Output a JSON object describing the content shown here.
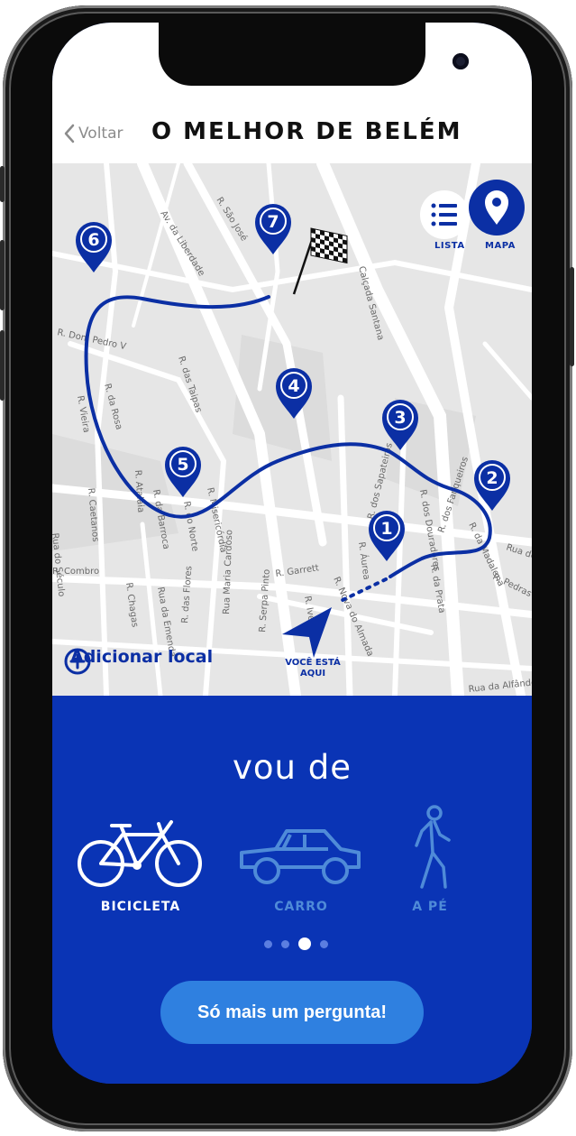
{
  "header": {
    "back_label": "Voltar",
    "title": "O MELHOR DE BELÉM"
  },
  "view_toggle": {
    "list_label": "LISTA",
    "map_label": "MAPA",
    "active": "MAPA"
  },
  "map": {
    "streets": [
      "Av. da Liberdade",
      "R. São José",
      "Calçada Santana",
      "R. Dom Pedro V",
      "R. das Taipas",
      "R. da Rosa",
      "R. Vieira",
      "R. Caetanos",
      "R. Atalaia",
      "R. da Barroca",
      "R. do Norte",
      "R. Misericórdia",
      "R. Garrett",
      "R. Ivens",
      "R. Nova do Almada",
      "R. Áurea",
      "R. dos Sapateiros",
      "R. dos Douradores",
      "R. dos Fanqueiros",
      "R. da Madalena",
      "R. da Prata",
      "Rua da Emenda",
      "R. das Flores",
      "R. Chagas",
      "Rua Maria Cardoso",
      "R. Serpa Pinto",
      "Rua da Alfândega",
      "Rua do Século",
      "R. Combro",
      "R. Pedras",
      "Rua de"
    ],
    "stops": [
      "1",
      "2",
      "3",
      "4",
      "5",
      "6",
      "7"
    ],
    "you_are_here": "VOCÊ ESTÁ AQUI",
    "add_place_label": "Adicionar local"
  },
  "transport": {
    "heading": "vou de",
    "options": [
      {
        "label": "BICICLETA",
        "icon": "bicycle-icon",
        "selected": true
      },
      {
        "label": "CARRO",
        "icon": "car-icon",
        "selected": false
      },
      {
        "label": "A PÉ",
        "icon": "pedestrian-icon",
        "selected": false
      }
    ],
    "page_indicator": {
      "total": 4,
      "current": 3
    }
  },
  "cta_label": "Só mais um pergunta!",
  "colors": {
    "brand_blue": "#0a34b5",
    "route_blue": "#0b2fa4",
    "cta_blue": "#2f80e0",
    "map_bg": "#e9e9e9"
  }
}
